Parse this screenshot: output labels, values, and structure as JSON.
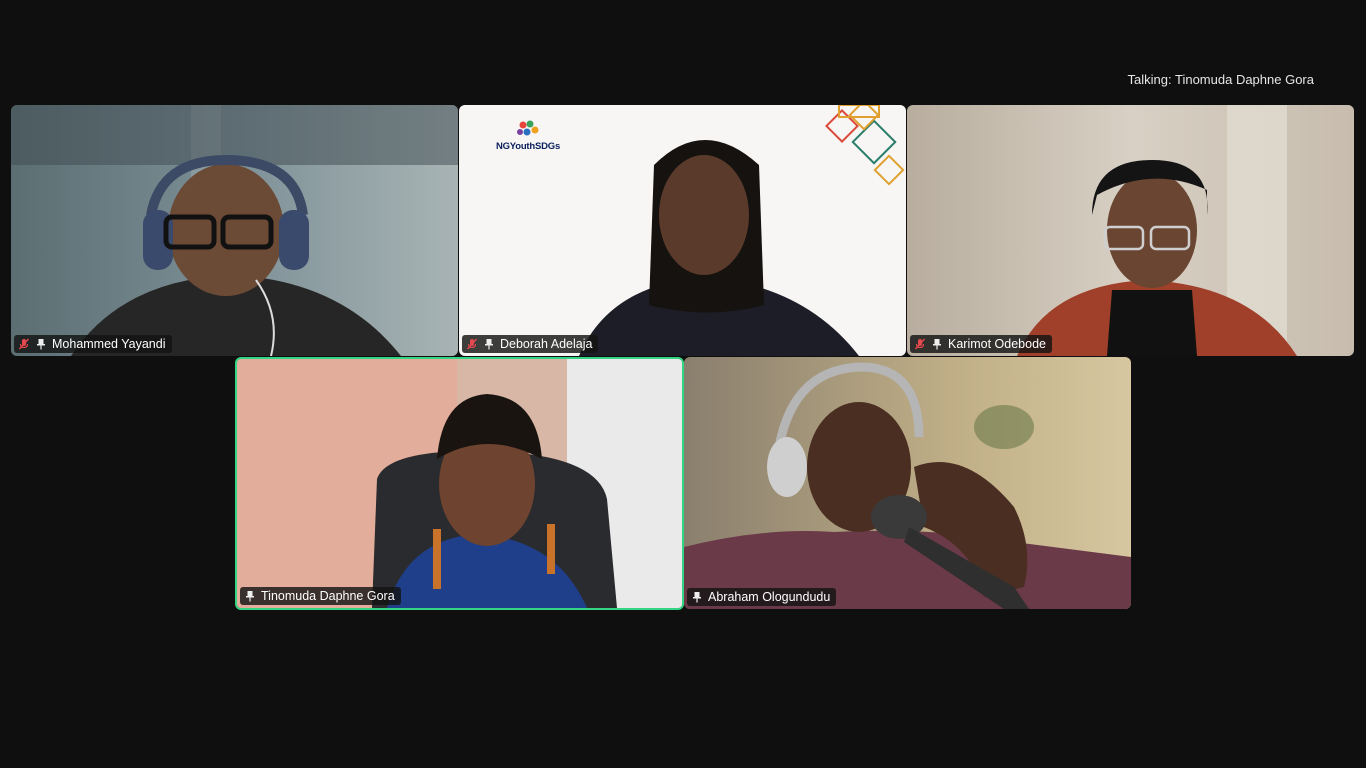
{
  "status": {
    "talking": "Talking: Tinomuda Daphne Gora"
  },
  "participants": [
    {
      "name": "Mohammed Yayandi",
      "muted": true,
      "pinned_icon": "pin-icon"
    },
    {
      "name": "Deborah Adelaja",
      "muted": true,
      "pinned_icon": "pin-icon"
    },
    {
      "name": "Karimot Odebode",
      "muted": true,
      "pinned_icon": "pin-icon"
    },
    {
      "name": "Tinomuda Daphne Gora",
      "muted": false,
      "pinned_icon": "pin-icon",
      "active_speaker": true
    },
    {
      "name": "Abraham Ologundudu",
      "muted": false,
      "pinned_icon": "pin-icon"
    }
  ],
  "virtual_background": {
    "logo_text": "NGYouthSDGs"
  },
  "colors": {
    "active_border": "#32d583",
    "muted_icon": "#e5484d",
    "background": "#0f0f0f"
  }
}
